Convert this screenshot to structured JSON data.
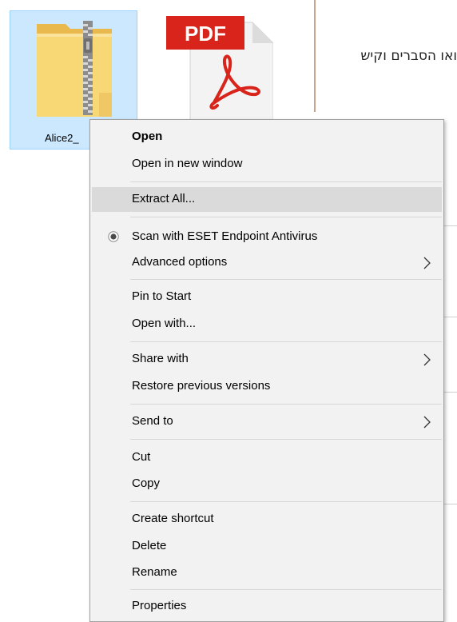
{
  "explorer": {
    "files": [
      {
        "name": "Alice2_",
        "icon": "zip-folder-icon",
        "selected": true
      },
      {
        "name": "",
        "icon": "pdf-file-icon",
        "selected": false
      }
    ],
    "pdf_badge": "PDF"
  },
  "side_window": {
    "text": "ואו הסברים וקיש"
  },
  "context_menu": {
    "items": [
      {
        "label": "Open",
        "bold": true
      },
      {
        "label": "Open in new window"
      },
      {
        "label": "Extract All...",
        "hovered": true
      },
      {
        "label": "Scan with ESET Endpoint Antivirus",
        "icon": "eset-icon"
      },
      {
        "label": "Advanced options",
        "submenu": true
      },
      {
        "label": "Pin to Start"
      },
      {
        "label": "Open with..."
      },
      {
        "label": "Share with",
        "submenu": true
      },
      {
        "label": "Restore previous versions"
      },
      {
        "label": "Send to",
        "submenu": true
      },
      {
        "label": "Cut"
      },
      {
        "label": "Copy"
      },
      {
        "label": "Create shortcut"
      },
      {
        "label": "Delete"
      },
      {
        "label": "Rename"
      },
      {
        "label": "Properties"
      }
    ]
  },
  "colors": {
    "selection_fill": "#cce8ff",
    "selection_border": "#99d1ff",
    "menu_background": "#f2f2f2",
    "menu_hover": "#dadada",
    "pdf_red": "#d9241b",
    "zip_folder_yellow": "#f8d775"
  }
}
